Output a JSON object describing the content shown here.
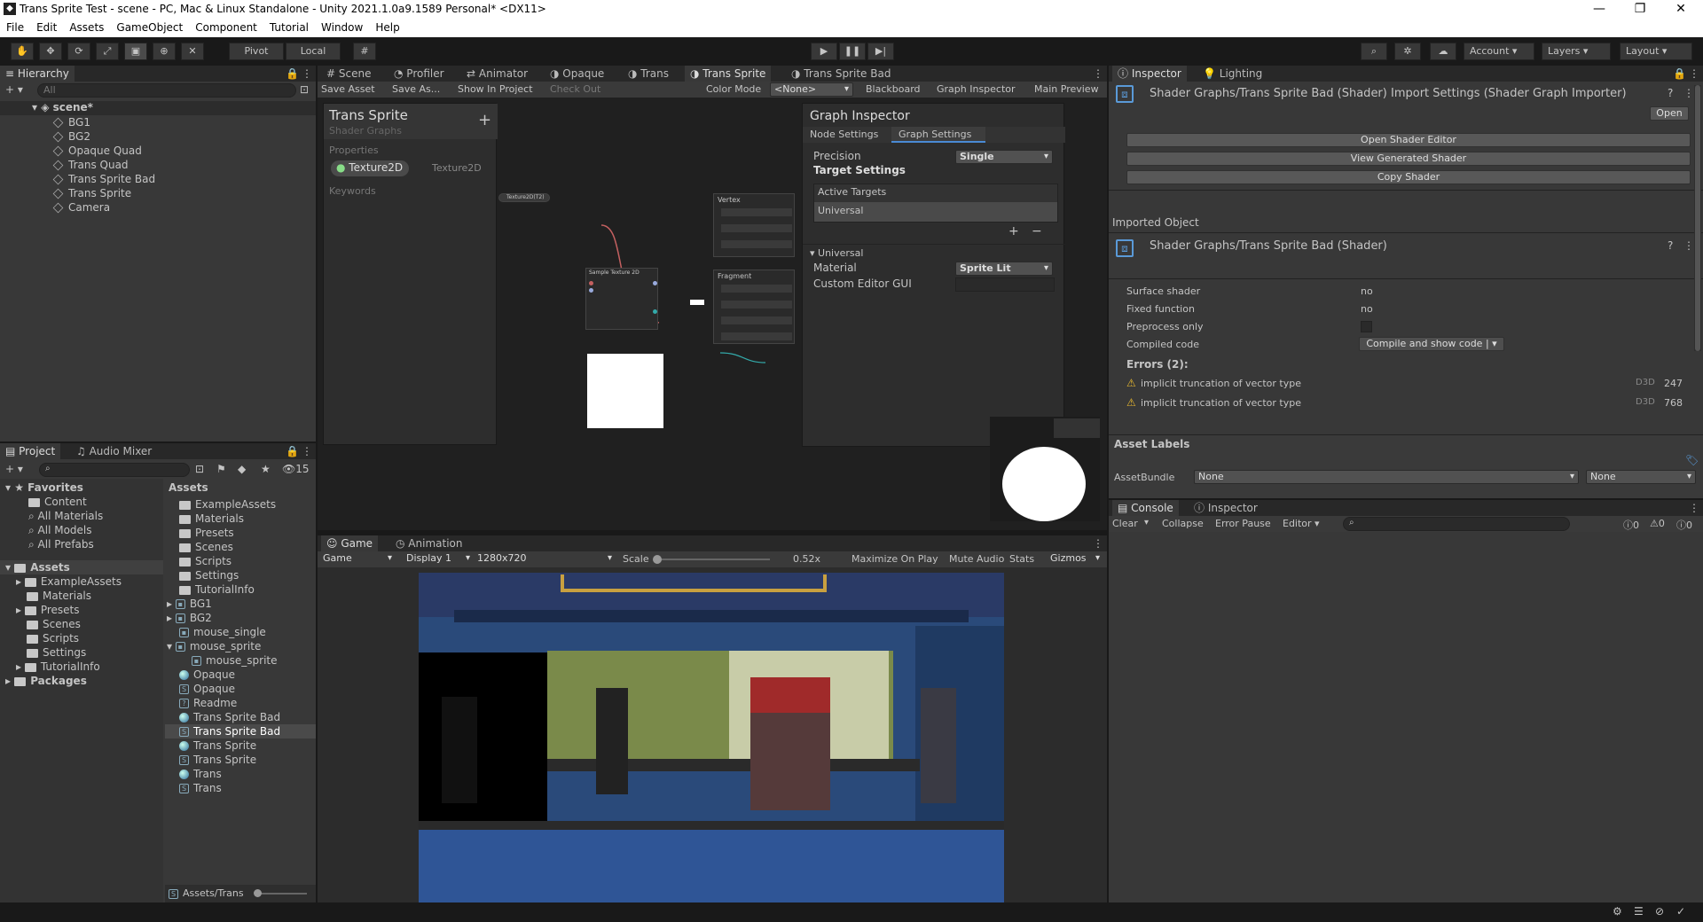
{
  "titlebar": {
    "title": "Trans Sprite Test - scene - PC, Mac & Linux Standalone - Unity 2021.1.0a9.1589 Personal* <DX11>"
  },
  "menu": [
    "File",
    "Edit",
    "Assets",
    "GameObject",
    "Component",
    "Tutorial",
    "Window",
    "Help"
  ],
  "toolbar": {
    "pivot": "Pivot",
    "local": "Local",
    "account": "Account",
    "layers": "Layers",
    "layout": "Layout"
  },
  "hierarchy": {
    "tab": "Hierarchy",
    "search": "All",
    "scene": "scene*",
    "items": [
      "BG1",
      "BG2",
      "Opaque Quad",
      "Trans Quad",
      "Trans Sprite Bad",
      "Trans Sprite",
      "Camera"
    ]
  },
  "project": {
    "tabs": [
      "Project",
      "Audio Mixer"
    ],
    "count": "15",
    "favorites": {
      "label": "Favorites",
      "items": [
        "Content",
        "All Materials",
        "All Models",
        "All Prefabs"
      ]
    },
    "assets_tree": {
      "label": "Assets",
      "items": [
        "ExampleAssets",
        "Materials",
        "Presets",
        "Scenes",
        "Scripts",
        "Settings",
        "TutorialInfo"
      ]
    },
    "packages": "Packages",
    "assets_header": "Assets",
    "assets_list": [
      "ExampleAssets",
      "Materials",
      "Presets",
      "Scenes",
      "Scripts",
      "Settings",
      "TutorialInfo",
      "BG1",
      "BG2",
      "mouse_single",
      "mouse_sprite",
      "mouse_sprite",
      "Opaque",
      "Opaque",
      "Readme",
      "Trans Sprite Bad",
      "Trans Sprite Bad",
      "Trans Sprite",
      "Trans Sprite",
      "Trans",
      "Trans"
    ],
    "footer": "Assets/Trans"
  },
  "center_tabs": [
    "Scene",
    "Profiler",
    "Animator",
    "Opaque",
    "Trans",
    "Trans Sprite",
    "Trans Sprite Bad"
  ],
  "sg_toolbar": {
    "save_asset": "Save Asset",
    "save_as": "Save As...",
    "show_in_project": "Show In Project",
    "check_out": "Check Out",
    "color_mode_label": "Color Mode",
    "color_mode": "<None>",
    "blackboard": "Blackboard",
    "graph_inspector": "Graph Inspector",
    "main_preview": "Main Preview"
  },
  "blackboard": {
    "title": "Trans Sprite",
    "subtitle": "Shader Graphs",
    "properties": "Properties",
    "prop_name": "Texture2D",
    "prop_type": "Texture2D",
    "keywords": "Keywords"
  },
  "graph_inspector": {
    "title": "Graph Inspector",
    "tab1": "Node Settings",
    "tab2": "Graph Settings",
    "precision_label": "Precision",
    "precision": "Single",
    "target_settings": "Target Settings",
    "active_targets": "Active Targets",
    "universal": "Universal",
    "universal_fold": "Universal",
    "material_label": "Material",
    "material": "Sprite Lit",
    "custom_gui": "Custom Editor GUI"
  },
  "nodes": {
    "vertex": "Vertex",
    "fragment": "Fragment",
    "sample": "Sample Texture 2D",
    "texture_prop": "Texture2D(T2)"
  },
  "game": {
    "tabs": [
      "Game",
      "Animation"
    ],
    "game_dd": "Game",
    "display": "Display 1",
    "resolution": "1280x720",
    "scale_label": "Scale",
    "scale_value": "0.52x",
    "maximize": "Maximize On Play",
    "mute": "Mute Audio",
    "stats": "Stats",
    "gizmos": "Gizmos"
  },
  "inspector": {
    "tabs": [
      "Inspector",
      "Lighting"
    ],
    "title": "Shader Graphs/Trans Sprite Bad (Shader) Import Settings (Shader Graph Importer)",
    "open": "Open",
    "open_editor": "Open Shader Editor",
    "view_generated": "View Generated Shader",
    "copy_shader": "Copy Shader",
    "imported_object": "Imported Object",
    "imported_title": "Shader Graphs/Trans Sprite Bad (Shader)",
    "props": [
      {
        "label": "Surface shader",
        "value": "no"
      },
      {
        "label": "Fixed function",
        "value": "no"
      },
      {
        "label": "Preprocess only",
        "value": ""
      },
      {
        "label": "Compiled code",
        "value": "Compile and show code |"
      }
    ],
    "errors_label": "Errors (2):",
    "errors": [
      {
        "msg": "implicit truncation of vector type",
        "api": "D3D",
        "line": "247"
      },
      {
        "msg": "implicit truncation of vector type",
        "api": "D3D",
        "line": "768"
      }
    ],
    "asset_labels": "Asset Labels",
    "assetbundle_label": "AssetBundle",
    "assetbundle": "None",
    "variant": "None"
  },
  "console": {
    "tabs": [
      "Console",
      "Inspector"
    ],
    "clear": "Clear",
    "collapse": "Collapse",
    "error_pause": "Error Pause",
    "editor": "Editor",
    "c_log": "0",
    "c_warn": "0",
    "c_err": "0"
  }
}
